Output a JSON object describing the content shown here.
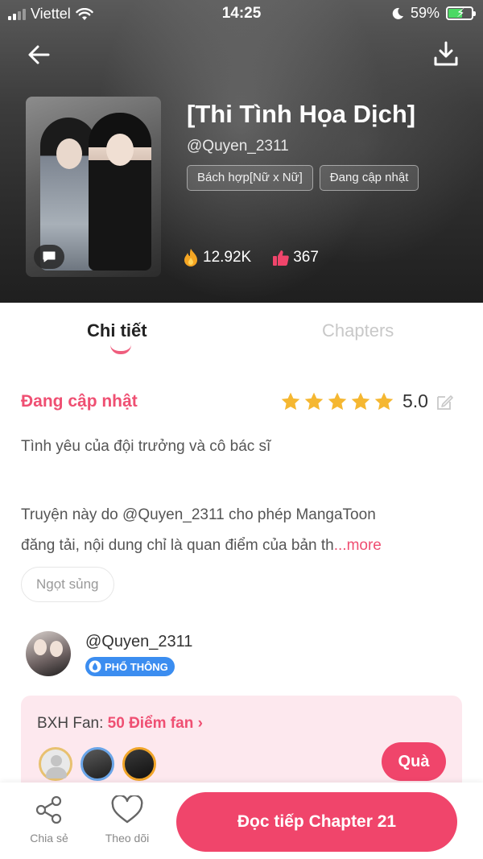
{
  "status_bar": {
    "carrier": "Viettel",
    "time": "14:25",
    "battery": "59%"
  },
  "book": {
    "title": "[Thi Tình Họa Dịch]",
    "author": "@Quyen_2311",
    "tags": [
      "Bách hợp[Nữ x Nữ]",
      "Đang cập nhật"
    ],
    "views": "12.92K",
    "likes": "367"
  },
  "tabs": {
    "details": "Chi tiết",
    "chapters": "Chapters"
  },
  "details": {
    "status": "Đang cập nhật",
    "stars": 5,
    "rating": "5.0",
    "description": "Tình yêu của đội trưởng và cô bác sĩ",
    "copyright_line1": "Truyện này do @Quyen_2311 cho phép MangaToon",
    "copyright_line2": "đăng tải, nội dung chỉ là quan điểm của bản th",
    "more_label": "...more",
    "genre_chip": "Ngọt sủng"
  },
  "author_card": {
    "name": "@Quyen_2311",
    "level": "PHỔ THÔNG"
  },
  "fan_ranking": {
    "label": "BXH Fan:",
    "points": "50 Điểm fan",
    "gift_button": "Quà"
  },
  "bottom_bar": {
    "share": "Chia sẻ",
    "follow": "Theo dõi",
    "read": "Đọc tiếp Chapter 21"
  },
  "colors": {
    "accent": "#f0456b",
    "star": "#f5b731",
    "fan_card_bg": "#fde8ee"
  }
}
